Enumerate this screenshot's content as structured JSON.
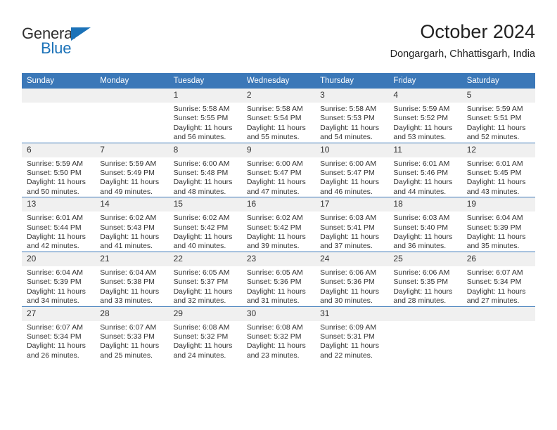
{
  "brand": {
    "name_top": "General",
    "name_bottom": "Blue",
    "accent_color": "#1b72b8"
  },
  "header": {
    "title": "October 2024",
    "subtitle": "Dongargarh, Chhattisgarh, India"
  },
  "theme": {
    "header_blue": "#3b78b8",
    "daynum_gray": "#f0f0f0",
    "text": "#333333"
  },
  "weekdays": [
    "Sunday",
    "Monday",
    "Tuesday",
    "Wednesday",
    "Thursday",
    "Friday",
    "Saturday"
  ],
  "labels": {
    "sunrise_prefix": "Sunrise:",
    "sunset_prefix": "Sunset:",
    "daylight_prefix": "Daylight:"
  },
  "weeks": [
    [
      {
        "day": "",
        "sunrise": "",
        "sunset": "",
        "daylight": ""
      },
      {
        "day": "",
        "sunrise": "",
        "sunset": "",
        "daylight": ""
      },
      {
        "day": "1",
        "sunrise": "Sunrise: 5:58 AM",
        "sunset": "Sunset: 5:55 PM",
        "daylight": "Daylight: 11 hours and 56 minutes."
      },
      {
        "day": "2",
        "sunrise": "Sunrise: 5:58 AM",
        "sunset": "Sunset: 5:54 PM",
        "daylight": "Daylight: 11 hours and 55 minutes."
      },
      {
        "day": "3",
        "sunrise": "Sunrise: 5:58 AM",
        "sunset": "Sunset: 5:53 PM",
        "daylight": "Daylight: 11 hours and 54 minutes."
      },
      {
        "day": "4",
        "sunrise": "Sunrise: 5:59 AM",
        "sunset": "Sunset: 5:52 PM",
        "daylight": "Daylight: 11 hours and 53 minutes."
      },
      {
        "day": "5",
        "sunrise": "Sunrise: 5:59 AM",
        "sunset": "Sunset: 5:51 PM",
        "daylight": "Daylight: 11 hours and 52 minutes."
      }
    ],
    [
      {
        "day": "6",
        "sunrise": "Sunrise: 5:59 AM",
        "sunset": "Sunset: 5:50 PM",
        "daylight": "Daylight: 11 hours and 50 minutes."
      },
      {
        "day": "7",
        "sunrise": "Sunrise: 5:59 AM",
        "sunset": "Sunset: 5:49 PM",
        "daylight": "Daylight: 11 hours and 49 minutes."
      },
      {
        "day": "8",
        "sunrise": "Sunrise: 6:00 AM",
        "sunset": "Sunset: 5:48 PM",
        "daylight": "Daylight: 11 hours and 48 minutes."
      },
      {
        "day": "9",
        "sunrise": "Sunrise: 6:00 AM",
        "sunset": "Sunset: 5:47 PM",
        "daylight": "Daylight: 11 hours and 47 minutes."
      },
      {
        "day": "10",
        "sunrise": "Sunrise: 6:00 AM",
        "sunset": "Sunset: 5:47 PM",
        "daylight": "Daylight: 11 hours and 46 minutes."
      },
      {
        "day": "11",
        "sunrise": "Sunrise: 6:01 AM",
        "sunset": "Sunset: 5:46 PM",
        "daylight": "Daylight: 11 hours and 44 minutes."
      },
      {
        "day": "12",
        "sunrise": "Sunrise: 6:01 AM",
        "sunset": "Sunset: 5:45 PM",
        "daylight": "Daylight: 11 hours and 43 minutes."
      }
    ],
    [
      {
        "day": "13",
        "sunrise": "Sunrise: 6:01 AM",
        "sunset": "Sunset: 5:44 PM",
        "daylight": "Daylight: 11 hours and 42 minutes."
      },
      {
        "day": "14",
        "sunrise": "Sunrise: 6:02 AM",
        "sunset": "Sunset: 5:43 PM",
        "daylight": "Daylight: 11 hours and 41 minutes."
      },
      {
        "day": "15",
        "sunrise": "Sunrise: 6:02 AM",
        "sunset": "Sunset: 5:42 PM",
        "daylight": "Daylight: 11 hours and 40 minutes."
      },
      {
        "day": "16",
        "sunrise": "Sunrise: 6:02 AM",
        "sunset": "Sunset: 5:42 PM",
        "daylight": "Daylight: 11 hours and 39 minutes."
      },
      {
        "day": "17",
        "sunrise": "Sunrise: 6:03 AM",
        "sunset": "Sunset: 5:41 PM",
        "daylight": "Daylight: 11 hours and 37 minutes."
      },
      {
        "day": "18",
        "sunrise": "Sunrise: 6:03 AM",
        "sunset": "Sunset: 5:40 PM",
        "daylight": "Daylight: 11 hours and 36 minutes."
      },
      {
        "day": "19",
        "sunrise": "Sunrise: 6:04 AM",
        "sunset": "Sunset: 5:39 PM",
        "daylight": "Daylight: 11 hours and 35 minutes."
      }
    ],
    [
      {
        "day": "20",
        "sunrise": "Sunrise: 6:04 AM",
        "sunset": "Sunset: 5:39 PM",
        "daylight": "Daylight: 11 hours and 34 minutes."
      },
      {
        "day": "21",
        "sunrise": "Sunrise: 6:04 AM",
        "sunset": "Sunset: 5:38 PM",
        "daylight": "Daylight: 11 hours and 33 minutes."
      },
      {
        "day": "22",
        "sunrise": "Sunrise: 6:05 AM",
        "sunset": "Sunset: 5:37 PM",
        "daylight": "Daylight: 11 hours and 32 minutes."
      },
      {
        "day": "23",
        "sunrise": "Sunrise: 6:05 AM",
        "sunset": "Sunset: 5:36 PM",
        "daylight": "Daylight: 11 hours and 31 minutes."
      },
      {
        "day": "24",
        "sunrise": "Sunrise: 6:06 AM",
        "sunset": "Sunset: 5:36 PM",
        "daylight": "Daylight: 11 hours and 30 minutes."
      },
      {
        "day": "25",
        "sunrise": "Sunrise: 6:06 AM",
        "sunset": "Sunset: 5:35 PM",
        "daylight": "Daylight: 11 hours and 28 minutes."
      },
      {
        "day": "26",
        "sunrise": "Sunrise: 6:07 AM",
        "sunset": "Sunset: 5:34 PM",
        "daylight": "Daylight: 11 hours and 27 minutes."
      }
    ],
    [
      {
        "day": "27",
        "sunrise": "Sunrise: 6:07 AM",
        "sunset": "Sunset: 5:34 PM",
        "daylight": "Daylight: 11 hours and 26 minutes."
      },
      {
        "day": "28",
        "sunrise": "Sunrise: 6:07 AM",
        "sunset": "Sunset: 5:33 PM",
        "daylight": "Daylight: 11 hours and 25 minutes."
      },
      {
        "day": "29",
        "sunrise": "Sunrise: 6:08 AM",
        "sunset": "Sunset: 5:32 PM",
        "daylight": "Daylight: 11 hours and 24 minutes."
      },
      {
        "day": "30",
        "sunrise": "Sunrise: 6:08 AM",
        "sunset": "Sunset: 5:32 PM",
        "daylight": "Daylight: 11 hours and 23 minutes."
      },
      {
        "day": "31",
        "sunrise": "Sunrise: 6:09 AM",
        "sunset": "Sunset: 5:31 PM",
        "daylight": "Daylight: 11 hours and 22 minutes."
      },
      {
        "day": "",
        "sunrise": "",
        "sunset": "",
        "daylight": ""
      },
      {
        "day": "",
        "sunrise": "",
        "sunset": "",
        "daylight": ""
      }
    ]
  ]
}
